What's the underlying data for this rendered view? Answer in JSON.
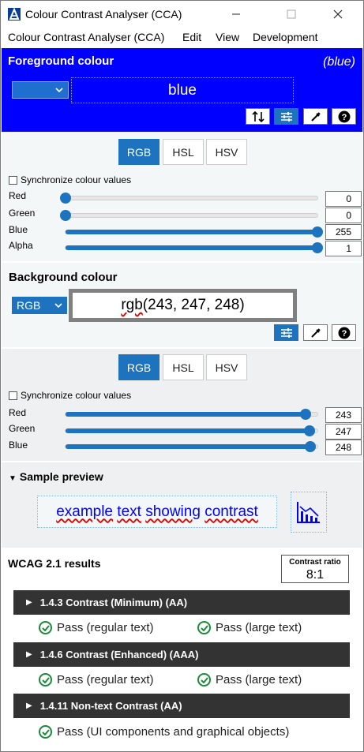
{
  "window": {
    "title": "Colour Contrast Analyser (CCA)"
  },
  "menu": [
    "Colour Contrast Analyser (CCA)",
    "Edit",
    "View",
    "Development"
  ],
  "foreground": {
    "title": "Foreground colour",
    "name": "(blue)",
    "value": "blue",
    "accent": "#0000ff",
    "tabs": [
      "RGB",
      "HSL",
      "HSV"
    ],
    "sync_label": "Synchronize colour values",
    "sliders": [
      {
        "label": "Red",
        "value": "0",
        "ratio": 0
      },
      {
        "label": "Green",
        "value": "0",
        "ratio": 0
      },
      {
        "label": "Blue",
        "value": "255",
        "ratio": 1
      },
      {
        "label": "Alpha",
        "value": "1",
        "ratio": 1
      }
    ]
  },
  "background": {
    "title": "Background colour",
    "format": "RGB",
    "value_fn": "rgb",
    "value_args": "(243, 247, 248)",
    "color": "#f3f7f8",
    "tabs": [
      "RGB",
      "HSL",
      "HSV"
    ],
    "sync_label": "Synchronize colour values",
    "sliders": [
      {
        "label": "Red",
        "value": "243",
        "ratio": 0.953
      },
      {
        "label": "Green",
        "value": "247",
        "ratio": 0.969
      },
      {
        "label": "Blue",
        "value": "248",
        "ratio": 0.973
      }
    ]
  },
  "sample": {
    "title": "Sample preview",
    "words": [
      "example",
      "text",
      "showing",
      "contrast"
    ]
  },
  "results": {
    "title": "WCAG 2.1 results",
    "ratio_label": "Contrast ratio",
    "ratio_value": "8:1",
    "criteria": [
      {
        "label": "1.4.3 Contrast (Minimum) (AA)",
        "results": [
          "Pass (regular text)",
          "Pass (large text)"
        ]
      },
      {
        "label": "1.4.6 Contrast (Enhanced) (AAA)",
        "results": [
          "Pass (regular text)",
          "Pass (large text)"
        ]
      },
      {
        "label": "1.4.11 Non-text Contrast (AA)",
        "results": [
          "Pass (UI components and graphical objects)"
        ]
      }
    ]
  }
}
